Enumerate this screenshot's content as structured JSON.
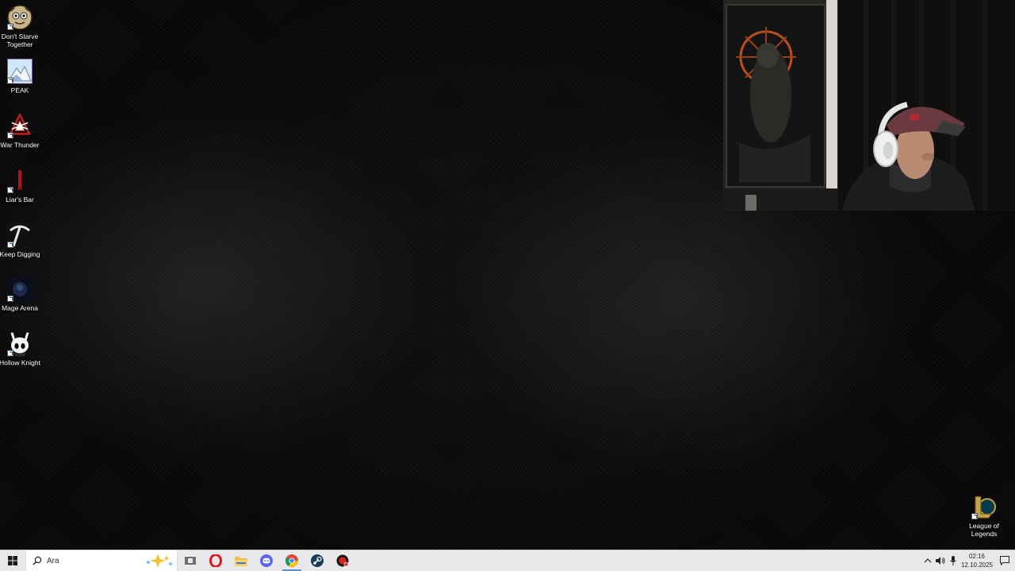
{
  "desktop_icons": [
    {
      "label": "Don't Starve Together",
      "icon": "dont-starve-together-icon"
    },
    {
      "label": "PEAK",
      "icon": "peak-icon"
    },
    {
      "label": "War Thunder",
      "icon": "war-thunder-icon"
    },
    {
      "label": "Liar's Bar",
      "icon": "liars-bar-icon"
    },
    {
      "label": "Keep Digging",
      "icon": "keep-digging-icon"
    },
    {
      "label": "Mage Arena",
      "icon": "mage-arena-icon"
    },
    {
      "label": "Hollow Knight",
      "icon": "hollow-knight-icon"
    },
    {
      "label": "League of Legends",
      "icon": "league-of-legends-icon"
    }
  ],
  "taskbar": {
    "search_placeholder": "Ara",
    "apps": [
      "start-icon",
      "task-view-icon",
      "opera-icon",
      "file-explorer-icon",
      "discord-icon",
      "chrome-icon",
      "steam-icon",
      "app-icon"
    ],
    "active_apps": [
      "chrome-icon"
    ],
    "clock": {
      "time": "02:16",
      "date": "12.10.2025"
    }
  },
  "colors": {
    "taskbar_bg": "#e8e8ea",
    "accent": "#5b8fd6"
  }
}
